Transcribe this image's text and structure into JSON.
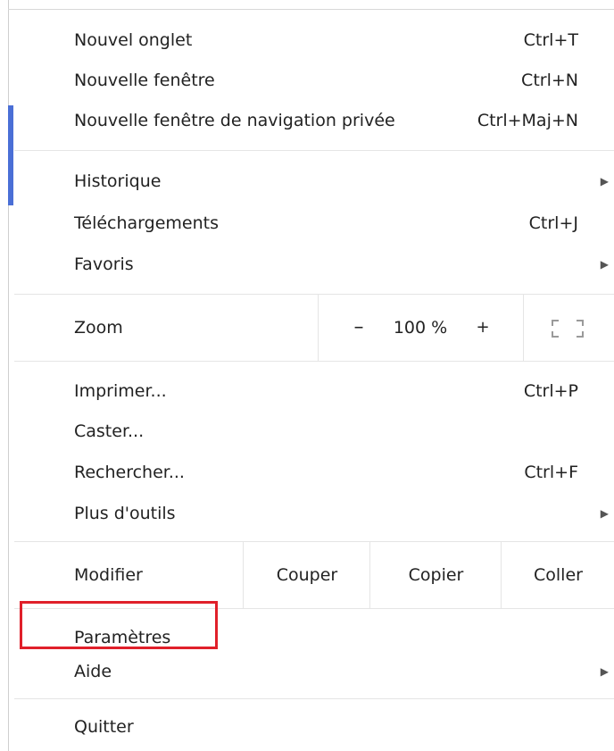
{
  "menu": {
    "group1": [
      {
        "label": "Nouvel onglet",
        "shortcut": "Ctrl+T"
      },
      {
        "label": "Nouvelle fenêtre",
        "shortcut": "Ctrl+N"
      },
      {
        "label": "Nouvelle fenêtre de navigation privée",
        "shortcut": "Ctrl+Maj+N"
      }
    ],
    "group2": [
      {
        "label": "Historique",
        "submenu": true
      },
      {
        "label": "Téléchargements",
        "shortcut": "Ctrl+J"
      },
      {
        "label": "Favoris",
        "submenu": true
      }
    ],
    "zoom": {
      "label": "Zoom",
      "minus": "–",
      "value": "100 %",
      "plus": "+",
      "icon": "fullscreen-icon"
    },
    "group3": [
      {
        "label": "Imprimer...",
        "shortcut": "Ctrl+P"
      },
      {
        "label": "Caster..."
      },
      {
        "label": "Rechercher...",
        "shortcut": "Ctrl+F"
      },
      {
        "label": "Plus d'outils",
        "submenu": true
      }
    ],
    "edit": {
      "label": "Modifier",
      "cut": "Couper",
      "copy": "Copier",
      "paste": "Coller"
    },
    "group4": [
      {
        "label": "Paramètres"
      },
      {
        "label": "Aide",
        "submenu": true
      }
    ],
    "quit": {
      "label": "Quitter"
    }
  },
  "colors": {
    "highlight": "#e0202a",
    "accent": "#4a6fd6"
  },
  "icons": {
    "submenu_arrow": "triangle-right-icon"
  }
}
